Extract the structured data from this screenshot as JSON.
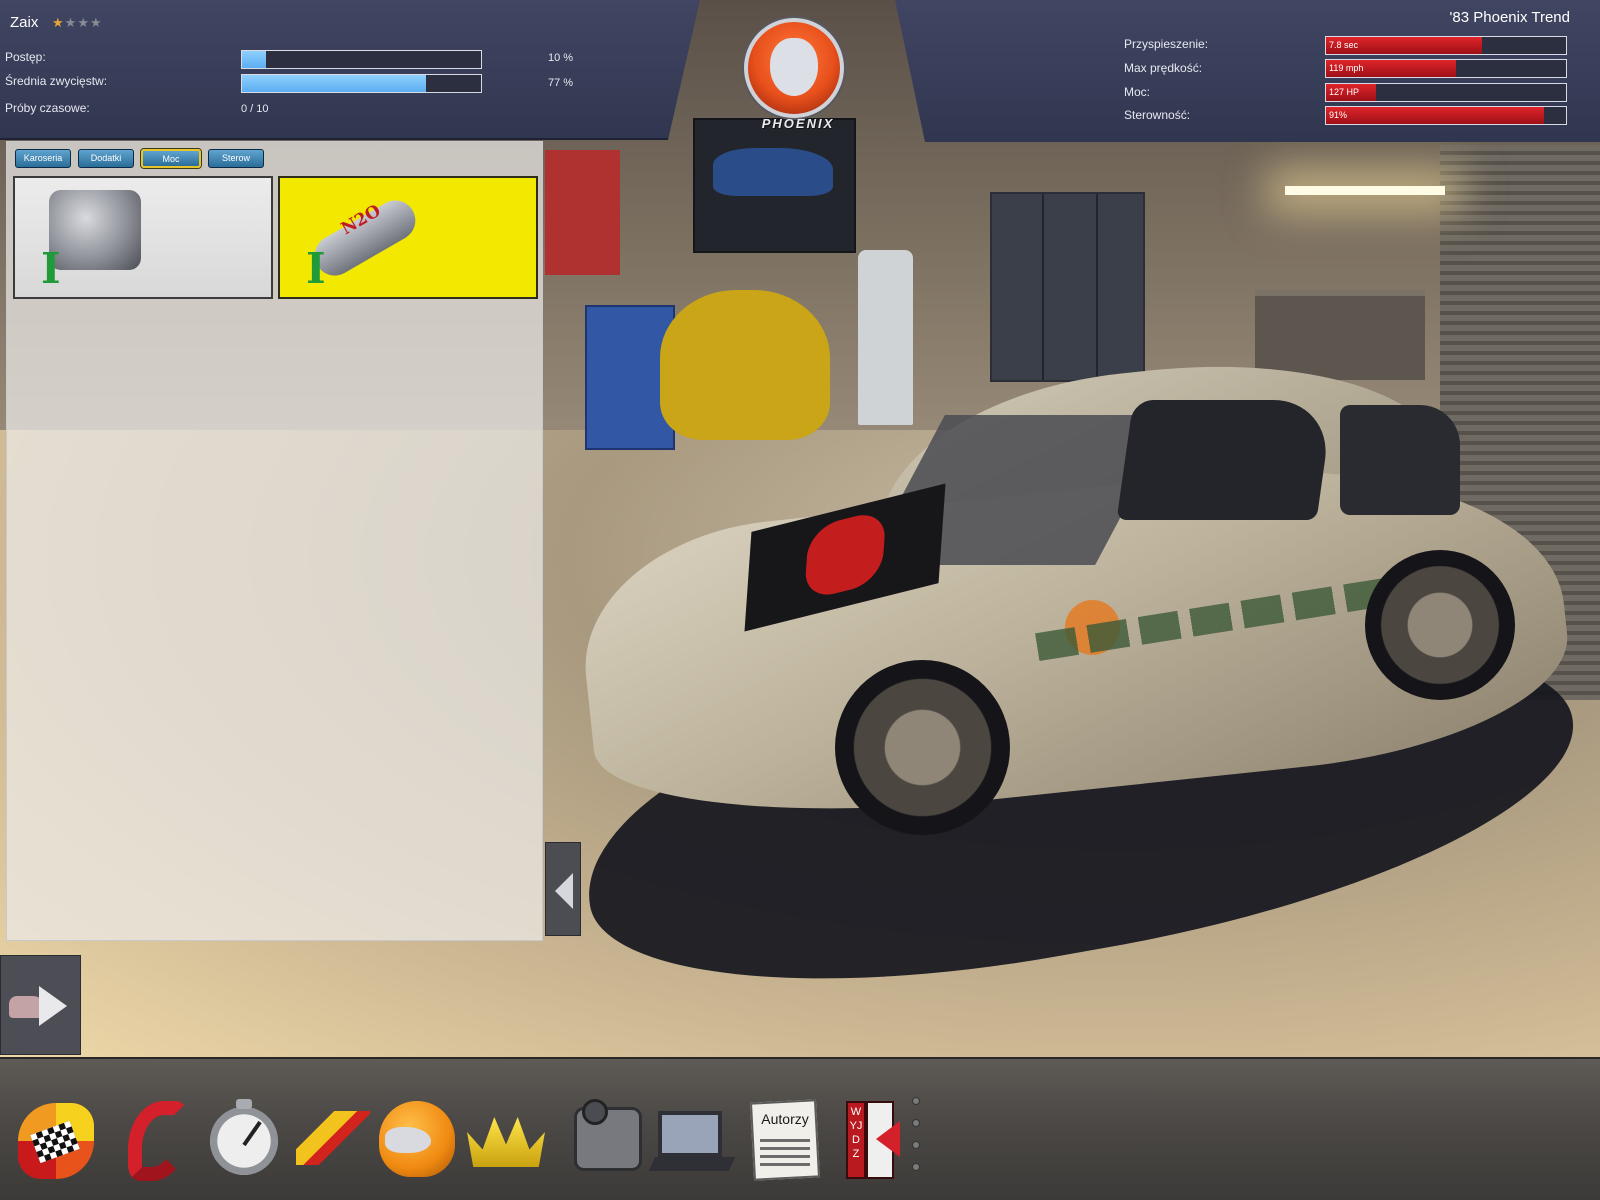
{
  "player": {
    "name": "Zaix",
    "stars_filled": 1,
    "stars_total": 4,
    "stats": [
      {
        "label": "Postęp:",
        "percent": 10,
        "display": "10 %"
      },
      {
        "label": "Średnia zwycięstw:",
        "percent": 77,
        "display": "77 %"
      },
      {
        "label": "Próby czasowe:",
        "display": "0 / 10"
      }
    ]
  },
  "car": {
    "name": "'83 Phoenix Trend",
    "brand": "PHOENIX",
    "performance": [
      {
        "label": "Przyspieszenie:",
        "value": "7.8 sec",
        "fraction": 0.65
      },
      {
        "label": "Max prędkość:",
        "value": "119 mph",
        "fraction": 0.54
      },
      {
        "label": "Moc:",
        "value": "127 HP",
        "fraction": 0.21
      },
      {
        "label": "Sterowność:",
        "value": "91%",
        "fraction": 0.91
      }
    ],
    "accent_color": "#c81d23"
  },
  "upgrade_panel": {
    "tabs": [
      {
        "label": "Karoseria",
        "active": false
      },
      {
        "label": "Dodatki",
        "active": false
      },
      {
        "label": "Moc",
        "active": true
      },
      {
        "label": "Sterow",
        "active": false
      }
    ],
    "parts": [
      {
        "icon": "engine-icon",
        "tier": "I",
        "selected": false
      },
      {
        "icon": "nitro-icon",
        "label": "N2O",
        "tier": "I",
        "selected": true
      }
    ],
    "selected_color": "#f3e800"
  },
  "toolbar": {
    "items": [
      {
        "icon": "race-flag-icon"
      },
      {
        "icon": "phone-icon"
      },
      {
        "icon": "stopwatch-icon"
      },
      {
        "icon": "tuning-icon"
      },
      {
        "icon": "helmet-icon"
      },
      {
        "icon": "crown-icon"
      },
      {
        "icon": "camera-icon"
      },
      {
        "icon": "laptop-icon"
      },
      {
        "icon": "credits-icon",
        "label": "Autorzy"
      },
      {
        "icon": "exit-icon",
        "label": "WYJDZ"
      }
    ]
  }
}
